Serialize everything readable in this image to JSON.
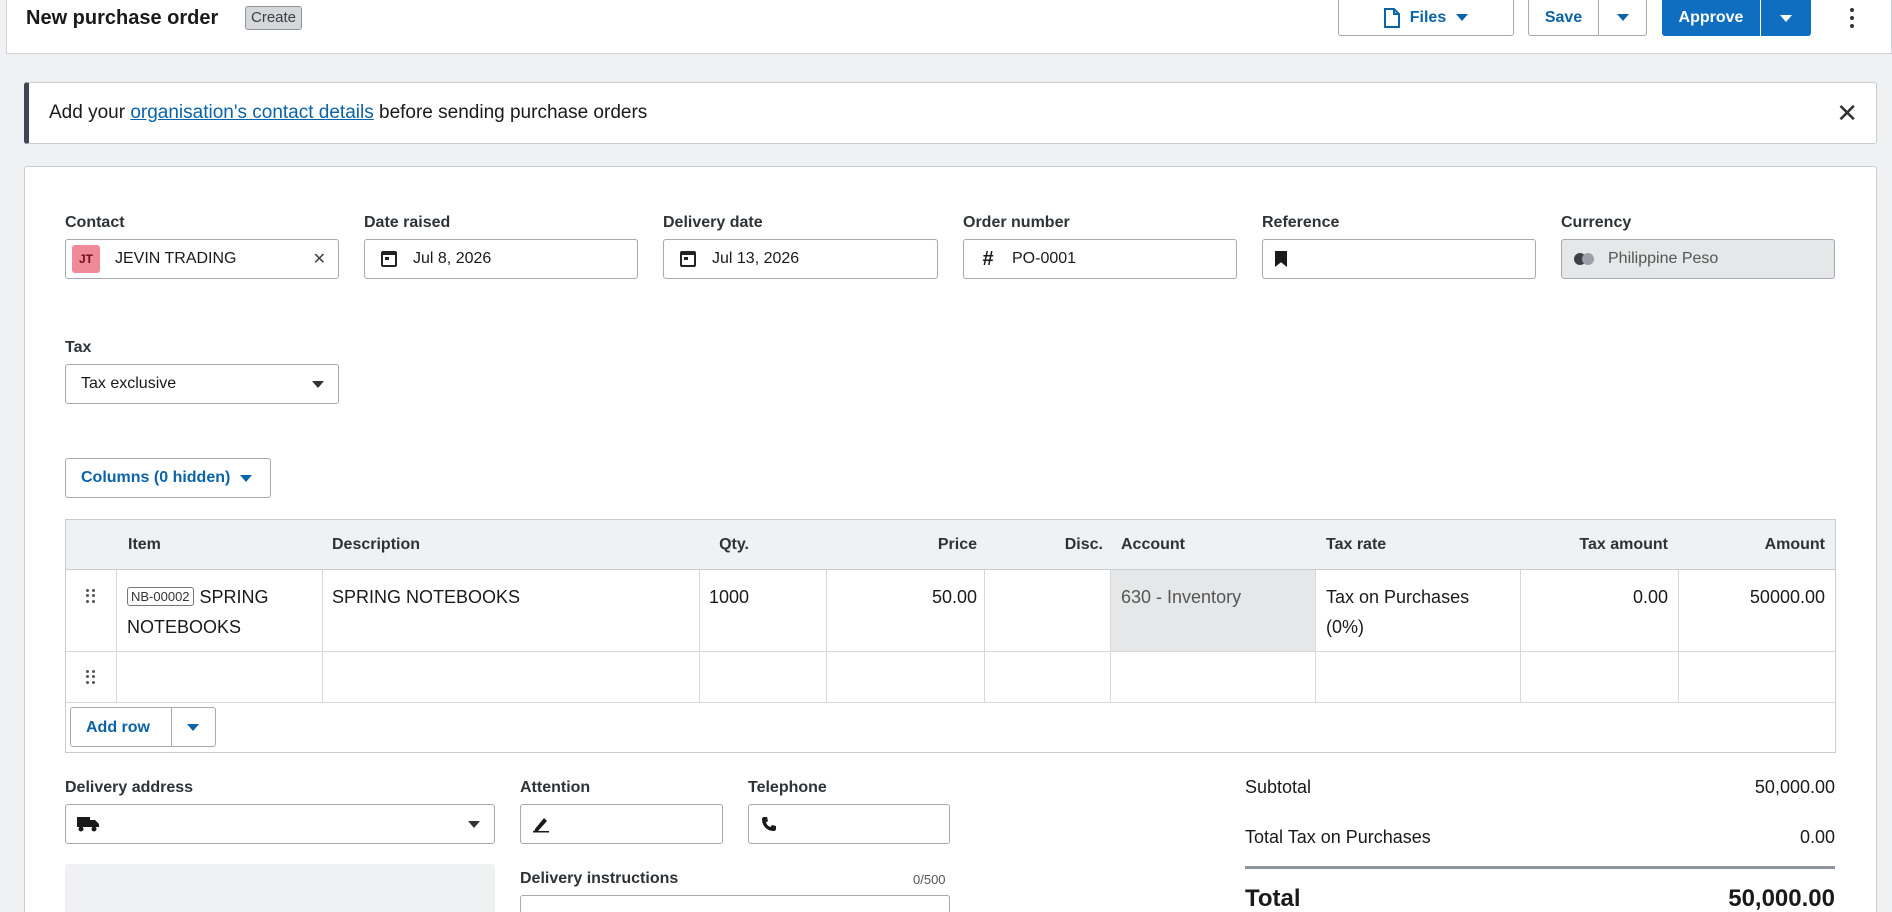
{
  "header": {
    "title": "New purchase order",
    "status": "Create",
    "files_label": "Files",
    "save_label": "Save",
    "approve_label": "Approve"
  },
  "banner": {
    "prefix": "Add your ",
    "link": "organisation's contact details",
    "suffix": " before sending purchase orders"
  },
  "form": {
    "contact": {
      "label": "Contact",
      "initials": "JT",
      "value": "JEVIN TRADING"
    },
    "date_raised": {
      "label": "Date raised",
      "value": "Jul 8, 2026"
    },
    "delivery_date": {
      "label": "Delivery date",
      "value": "Jul 13, 2026"
    },
    "order_number": {
      "label": "Order number",
      "value": "PO-0001"
    },
    "reference": {
      "label": "Reference",
      "value": ""
    },
    "currency": {
      "label": "Currency",
      "value": "Philippine Peso"
    },
    "tax": {
      "label": "Tax",
      "value": "Tax exclusive"
    }
  },
  "columns_button": "Columns (0 hidden)",
  "table": {
    "headers": {
      "item": "Item",
      "description": "Description",
      "qty": "Qty.",
      "price": "Price",
      "disc": "Disc.",
      "account": "Account",
      "tax_rate": "Tax rate",
      "tax_amount": "Tax amount",
      "amount": "Amount"
    },
    "rows": [
      {
        "item_code": "NB-00002",
        "item_name": "SPRING NOTEBOOKS",
        "description": "SPRING NOTEBOOKS",
        "qty": "1000",
        "price": "50.00",
        "disc": "",
        "account": "630 - Inventory",
        "tax_rate": "Tax on Purchases (0%)",
        "tax_amount": "0.00",
        "amount": "50000.00"
      }
    ],
    "add_row_label": "Add row"
  },
  "delivery": {
    "address_label": "Delivery address",
    "attention_label": "Attention",
    "telephone_label": "Telephone",
    "instructions_label": "Delivery instructions",
    "instructions_count": "0/500"
  },
  "summary": {
    "subtotal_label": "Subtotal",
    "subtotal_value": "50,000.00",
    "tax_label": "Total Tax on Purchases",
    "tax_value": "0.00",
    "total_label": "Total",
    "total_value": "50,000.00"
  },
  "colors": {
    "primary": "#0f6ec0",
    "link": "#0b63a8",
    "avatar": "#ef8a99"
  }
}
